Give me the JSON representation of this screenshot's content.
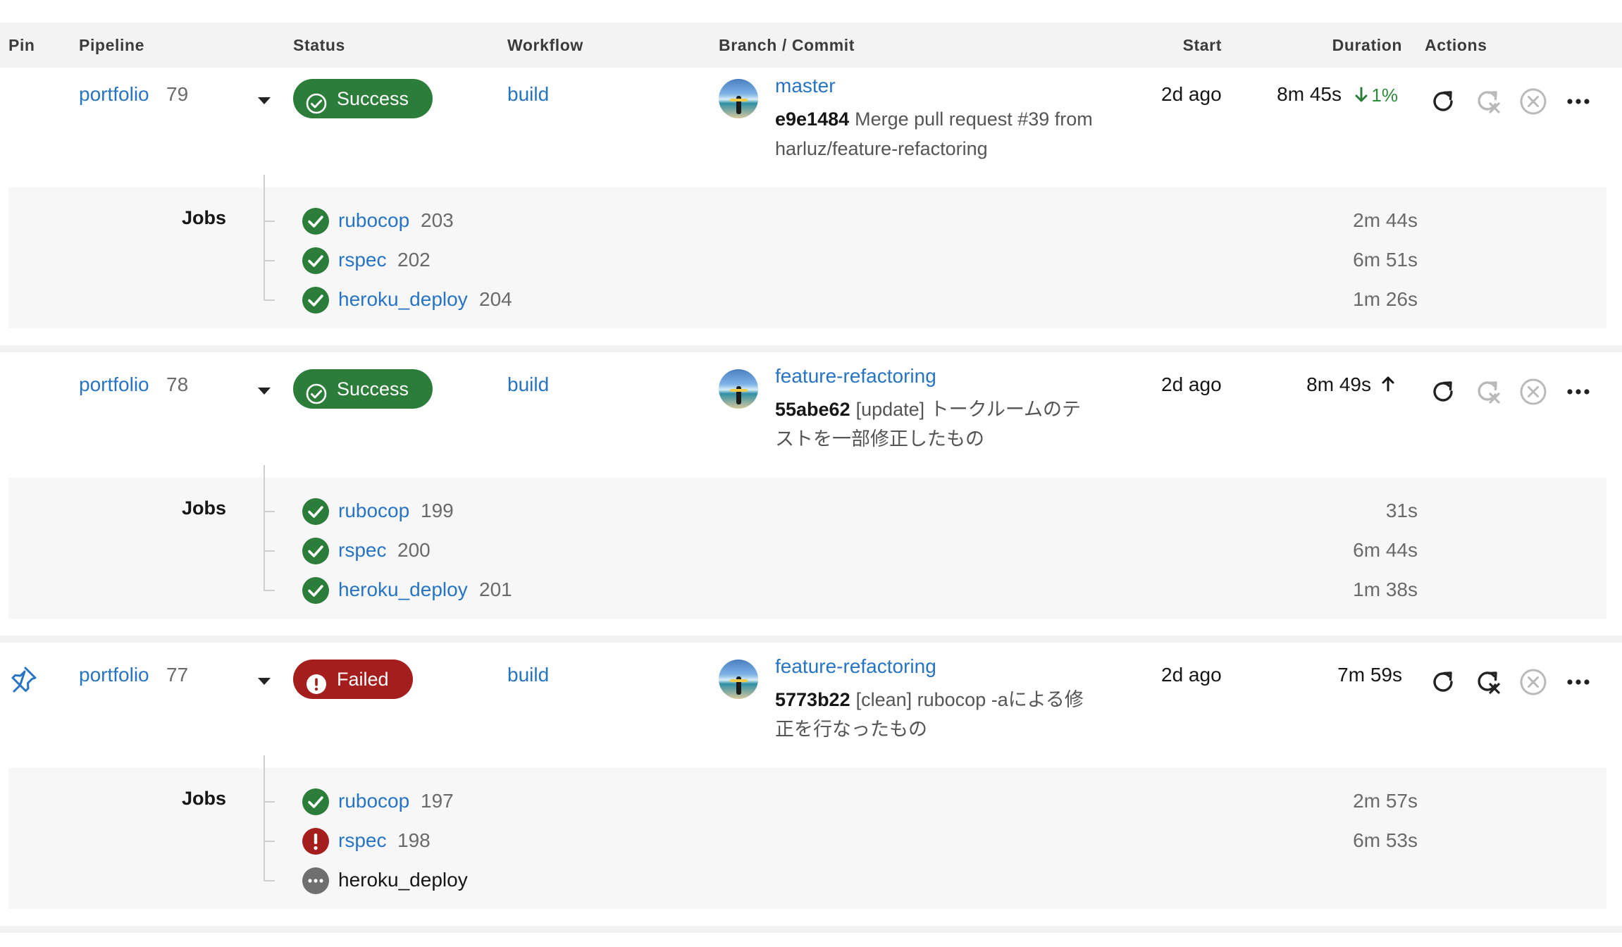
{
  "headers": {
    "pin": "Pin",
    "pipeline": "Pipeline",
    "status": "Status",
    "workflow": "Workflow",
    "branch_commit": "Branch / Commit",
    "start": "Start",
    "duration": "Duration",
    "actions": "Actions"
  },
  "jobs_label": "Jobs",
  "icons": {
    "rerun": "rerun-icon",
    "rerun_failed": "rerun-failed-icon",
    "cancel": "cancel-icon",
    "more": "more-icon",
    "pin": "pin-icon"
  },
  "colors": {
    "success": "#2c7d3a",
    "failed": "#a51e1e",
    "link": "#2774c4",
    "not_run": "#6f6f6f"
  },
  "pipelines": [
    {
      "project": "portfolio",
      "number": "79",
      "status": "Success",
      "pinned": false,
      "workflow": "build",
      "branch": "master",
      "commit_sha": "e9e1484",
      "commit_message": "Merge pull request #39 from harluz/feature-refactoring",
      "start": "2d ago",
      "duration": "8m 45s",
      "duration_change": "1%",
      "duration_trend": "down",
      "jobs": [
        {
          "name": "rubocop",
          "number": "203",
          "status": "success",
          "duration": "2m 44s"
        },
        {
          "name": "rspec",
          "number": "202",
          "status": "success",
          "duration": "6m 51s"
        },
        {
          "name": "heroku_deploy",
          "number": "204",
          "status": "success",
          "duration": "1m 26s"
        }
      ]
    },
    {
      "project": "portfolio",
      "number": "78",
      "status": "Success",
      "pinned": false,
      "workflow": "build",
      "branch": "feature-refactoring",
      "commit_sha": "55abe62",
      "commit_message": "[update] トークルームのテストを一部修正したもの",
      "start": "2d ago",
      "duration": "8m 49s",
      "duration_change": "",
      "duration_trend": "up",
      "jobs": [
        {
          "name": "rubocop",
          "number": "199",
          "status": "success",
          "duration": "31s"
        },
        {
          "name": "rspec",
          "number": "200",
          "status": "success",
          "duration": "6m 44s"
        },
        {
          "name": "heroku_deploy",
          "number": "201",
          "status": "success",
          "duration": "1m 38s"
        }
      ]
    },
    {
      "project": "portfolio",
      "number": "77",
      "status": "Failed",
      "pinned": true,
      "workflow": "build",
      "branch": "feature-refactoring",
      "commit_sha": "5773b22",
      "commit_message": "[clean] rubocop -aによる修正を行なったもの",
      "start": "2d ago",
      "duration": "7m 59s",
      "duration_change": "",
      "duration_trend": "none",
      "jobs": [
        {
          "name": "rubocop",
          "number": "197",
          "status": "success",
          "duration": "2m 57s"
        },
        {
          "name": "rspec",
          "number": "198",
          "status": "failed",
          "duration": "6m 53s"
        },
        {
          "name": "heroku_deploy",
          "number": "",
          "status": "not_run",
          "duration": ""
        }
      ]
    }
  ]
}
